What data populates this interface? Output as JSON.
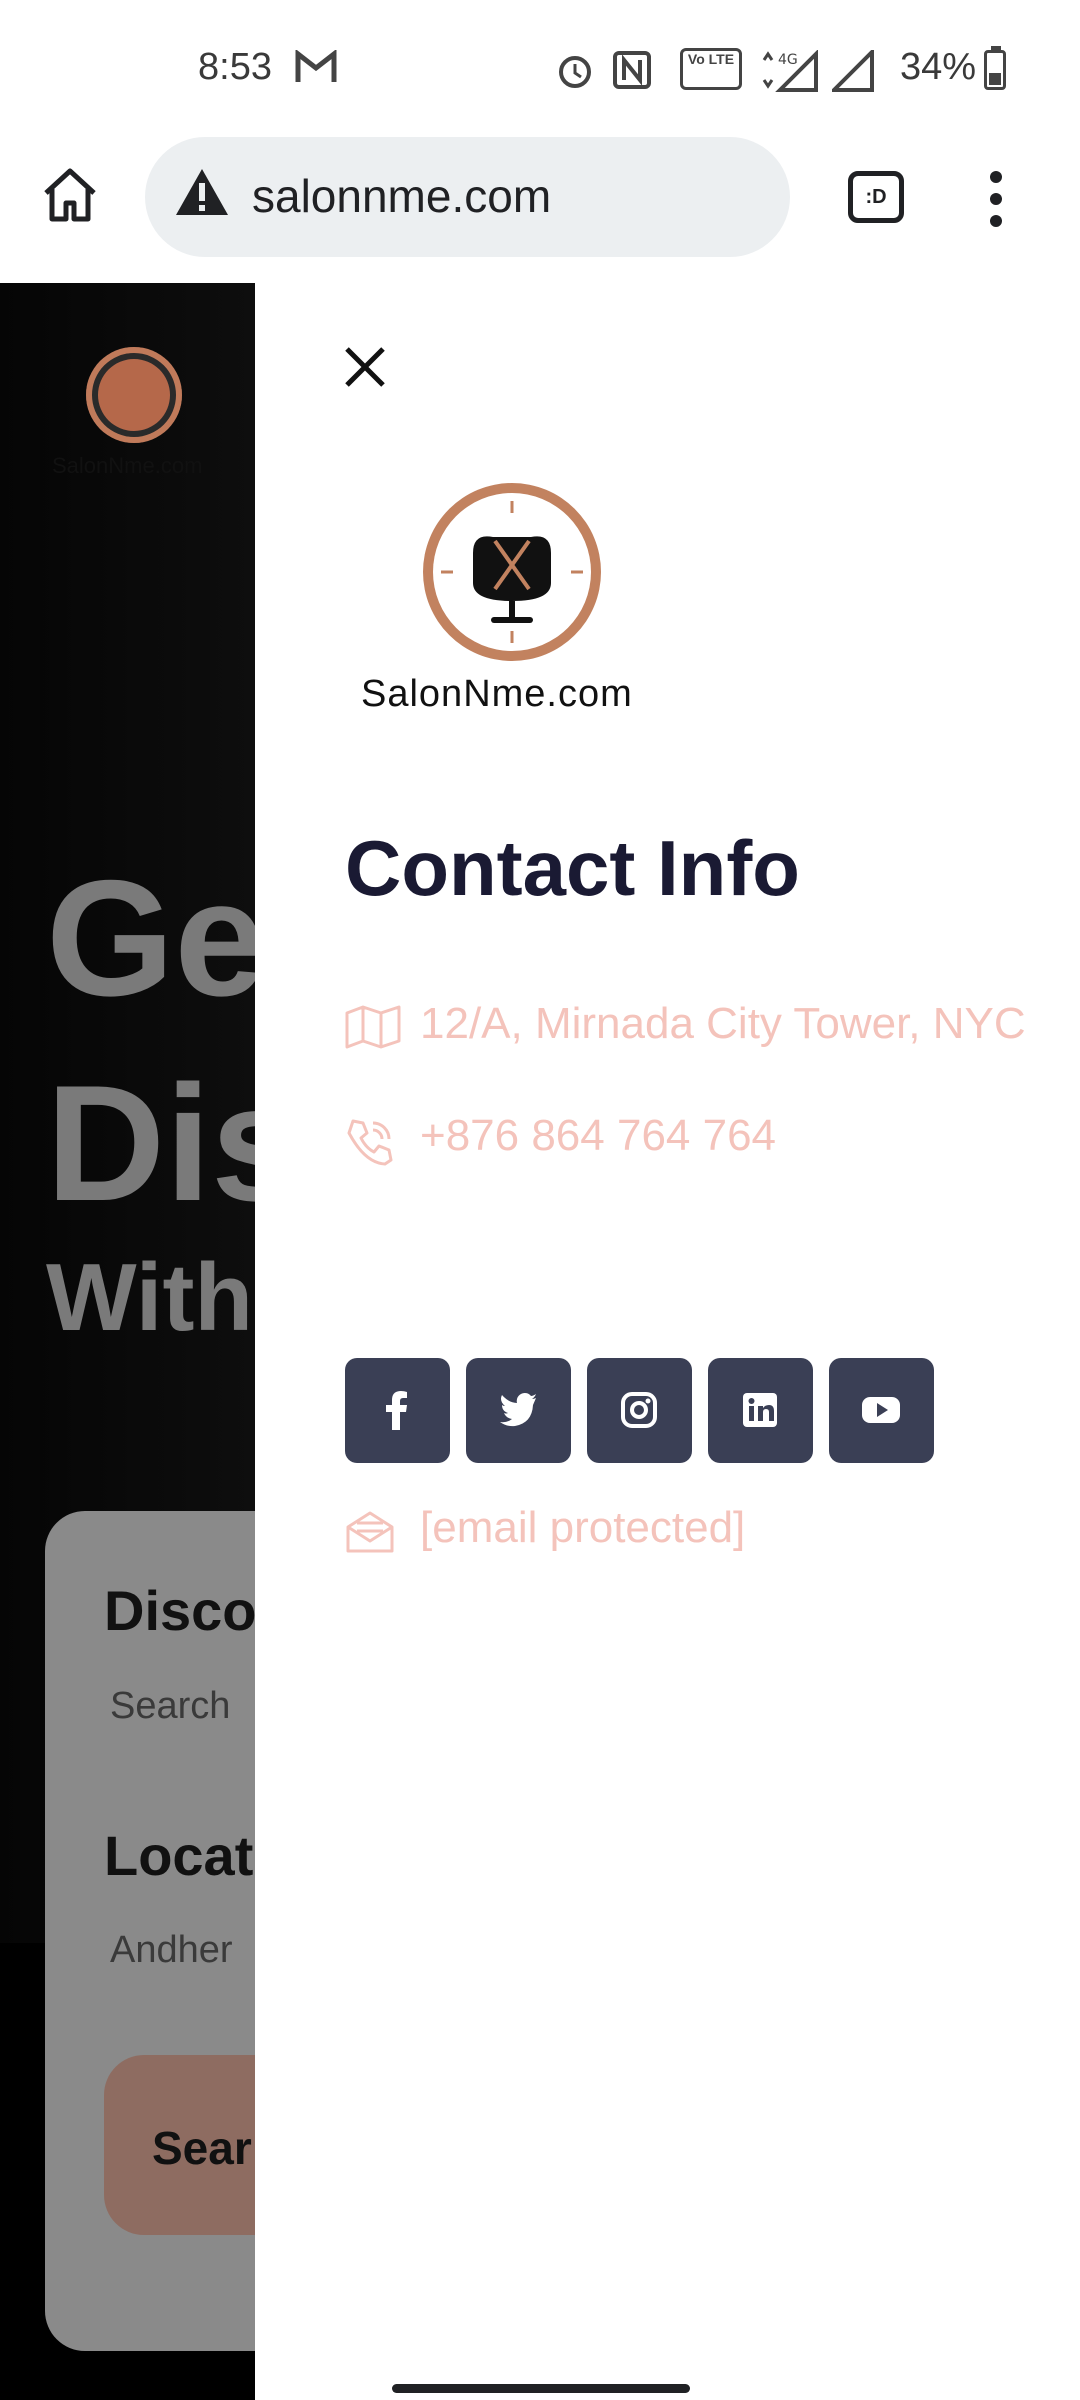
{
  "status_bar": {
    "time": "8:53",
    "battery_percent": "34%",
    "network": "4G",
    "volte_label": "Vo LTE"
  },
  "browser": {
    "url": "salonnme.com",
    "tab_icon_text": ":D"
  },
  "background_page": {
    "logo_text": "SalonNme.com",
    "hero_line1": "Ge",
    "hero_line2": "Dis",
    "hero_line3": "With",
    "search_card": {
      "discover_label": "Disco",
      "search_placeholder": "Search",
      "location_label": "Locat",
      "location_value": "Andher",
      "search_button": "Sear"
    }
  },
  "drawer": {
    "logo_text": "SalonNme.com",
    "title": "Contact Info",
    "address": "12/A, Mirnada City Tower, NYC",
    "phone": "+876 864 764 764",
    "email": "[email protected]",
    "social": [
      "facebook",
      "twitter",
      "instagram",
      "linkedin",
      "youtube"
    ],
    "accent_color": "#f4c3bb",
    "social_bg": "#3a3f55"
  }
}
